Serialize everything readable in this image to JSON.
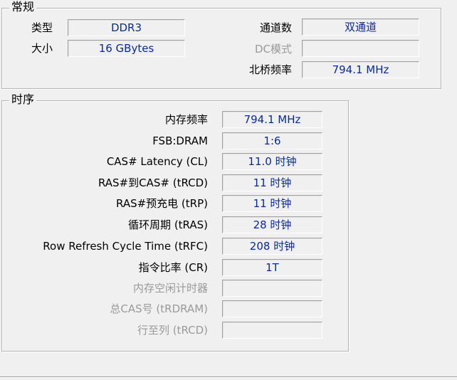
{
  "general": {
    "title": "常规",
    "type_label": "类型",
    "type_value": "DDR3",
    "size_label": "大小",
    "size_value": "16 GBytes",
    "channels_label": "通道数",
    "channels_value": "双通道",
    "dc_mode_label": "DC模式",
    "dc_mode_value": "",
    "nb_freq_label": "北桥频率",
    "nb_freq_value": "794.1 MHz"
  },
  "timings": {
    "title": "时序",
    "rows": [
      {
        "label": "内存频率",
        "value": "794.1 MHz",
        "enabled": true
      },
      {
        "label": "FSB:DRAM",
        "value": "1:6",
        "enabled": true
      },
      {
        "label": "CAS# Latency (CL)",
        "value": "11.0 时钟",
        "enabled": true
      },
      {
        "label": "RAS#到CAS# (tRCD)",
        "value": "11 时钟",
        "enabled": true
      },
      {
        "label": "RAS#预充电 (tRP)",
        "value": "11 时钟",
        "enabled": true
      },
      {
        "label": "循环周期 (tRAS)",
        "value": "28 时钟",
        "enabled": true
      },
      {
        "label": "Row Refresh Cycle Time (tRFC)",
        "value": "208 时钟",
        "enabled": true
      },
      {
        "label": "指令比率 (CR)",
        "value": "1T",
        "enabled": true
      },
      {
        "label": "内存空闲计时器",
        "value": "",
        "enabled": false
      },
      {
        "label": "总CAS号 (tRDRAM)",
        "value": "",
        "enabled": false
      },
      {
        "label": "行至列 (tRCD)",
        "value": "",
        "enabled": false
      }
    ]
  }
}
